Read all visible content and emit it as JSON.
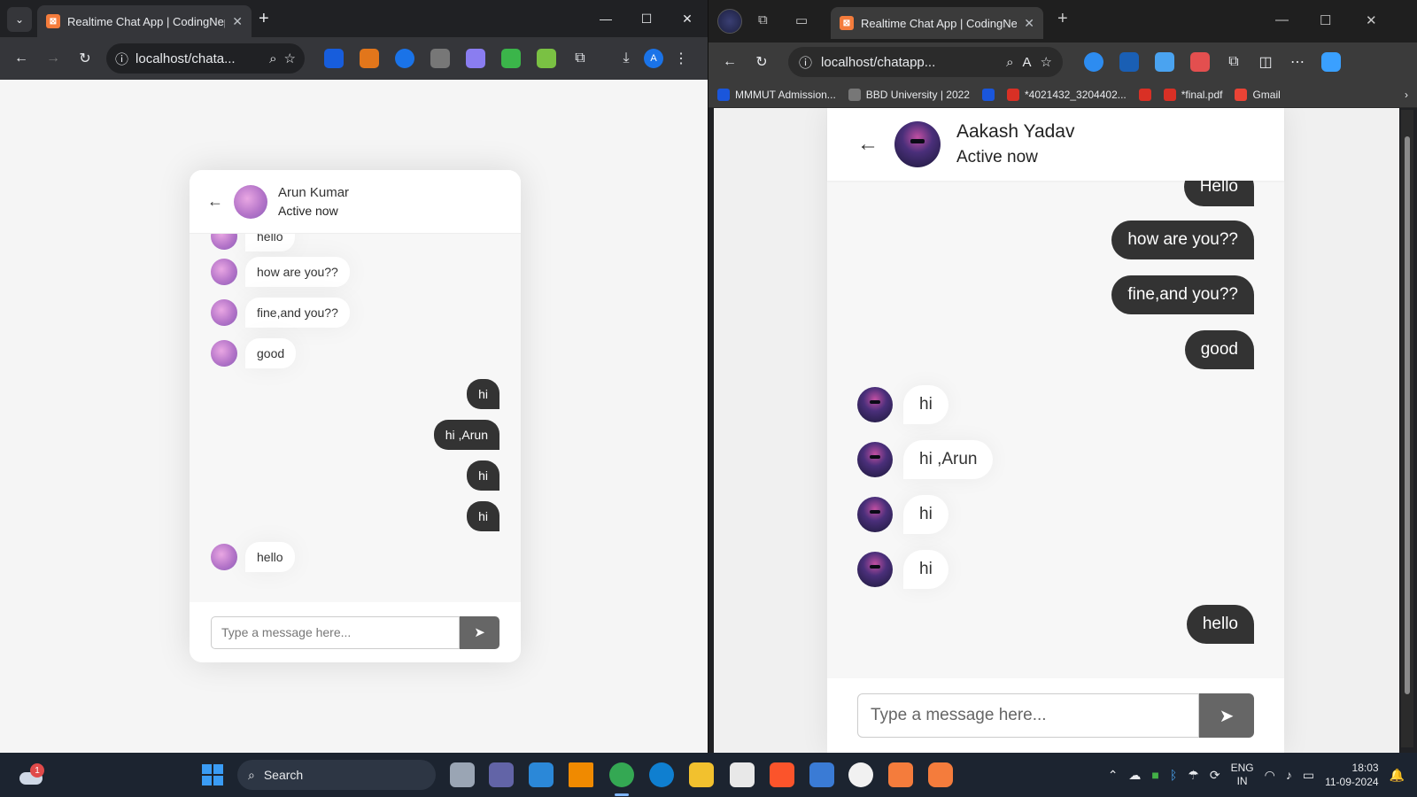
{
  "left_window": {
    "tab_title": "Realtime Chat App | CodingNepal",
    "url": "localhost/chata...",
    "profile_letter": "A",
    "chat": {
      "name": "Arun Kumar",
      "status": "Active now",
      "messages": [
        {
          "dir": "in",
          "text": "hello"
        },
        {
          "dir": "in",
          "text": "how are you??"
        },
        {
          "dir": "in",
          "text": "fine,and you??"
        },
        {
          "dir": "in",
          "text": "good"
        },
        {
          "dir": "out",
          "text": "hi"
        },
        {
          "dir": "out",
          "text": "hi ,Arun"
        },
        {
          "dir": "out",
          "text": "hi"
        },
        {
          "dir": "out",
          "text": "hi"
        },
        {
          "dir": "in",
          "text": "hello"
        }
      ],
      "input_placeholder": "Type a message here..."
    }
  },
  "right_window": {
    "tab_title": "Realtime Chat App | CodingNepal",
    "url": "localhost/chatapp...",
    "bookmarks": [
      "MMMUT Admission...",
      "BBD University | 2022",
      "*4021432_3204402...",
      "*final.pdf",
      "Gmail"
    ],
    "chat": {
      "name": "Aakash Yadav",
      "status": "Active now",
      "messages": [
        {
          "dir": "out",
          "text": "Hello"
        },
        {
          "dir": "out",
          "text": "how are you??"
        },
        {
          "dir": "out",
          "text": "fine,and you??"
        },
        {
          "dir": "out",
          "text": "good"
        },
        {
          "dir": "in",
          "text": "hi"
        },
        {
          "dir": "in",
          "text": "hi ,Arun"
        },
        {
          "dir": "in",
          "text": "hi"
        },
        {
          "dir": "in",
          "text": "hi"
        },
        {
          "dir": "out",
          "text": "hello"
        }
      ],
      "input_placeholder": "Type a message here..."
    }
  },
  "taskbar": {
    "search_label": "Search",
    "notification_count": "1",
    "language": "ENG",
    "region": "IN",
    "time": "18:03",
    "date": "11-09-2024"
  },
  "colors": {
    "outgoing_bubble": "#333333",
    "incoming_bubble": "#ffffff",
    "send_button": "#666666",
    "favicon": "#f47c3c"
  }
}
